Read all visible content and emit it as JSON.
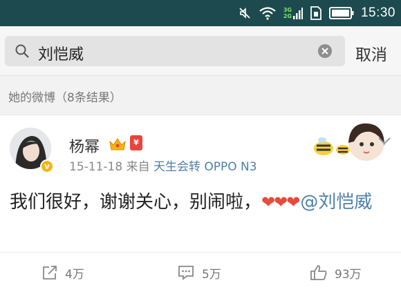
{
  "status_bar": {
    "time": "15:30",
    "network_label_top": "3G",
    "network_label_bottom": "2G",
    "icons": [
      "mute-icon",
      "wifi-icon",
      "signal-icon",
      "sim-icon",
      "battery-icon"
    ]
  },
  "search": {
    "query": "刘恺威",
    "cancel_label": "取消"
  },
  "section": {
    "title": "她的微博（8条结果）"
  },
  "post": {
    "author": "杨幂",
    "date": "15-11-18",
    "from_label": "来自",
    "source": "天生会转 OPPO N3",
    "verified_badge": "v",
    "vip_badge_label": "¥",
    "text": "我们很好，谢谢关心，别闹啦，",
    "hearts": "❤❤❤",
    "mention": "@刘恺威",
    "actions": {
      "repost_count": "4万",
      "comment_count": "5万",
      "like_count": "93万"
    }
  },
  "colors": {
    "status_bar_bg": "#1d4a4e",
    "link": "#4e7fa8",
    "heart": "#e84a3b",
    "verified": "#f6b50e"
  }
}
